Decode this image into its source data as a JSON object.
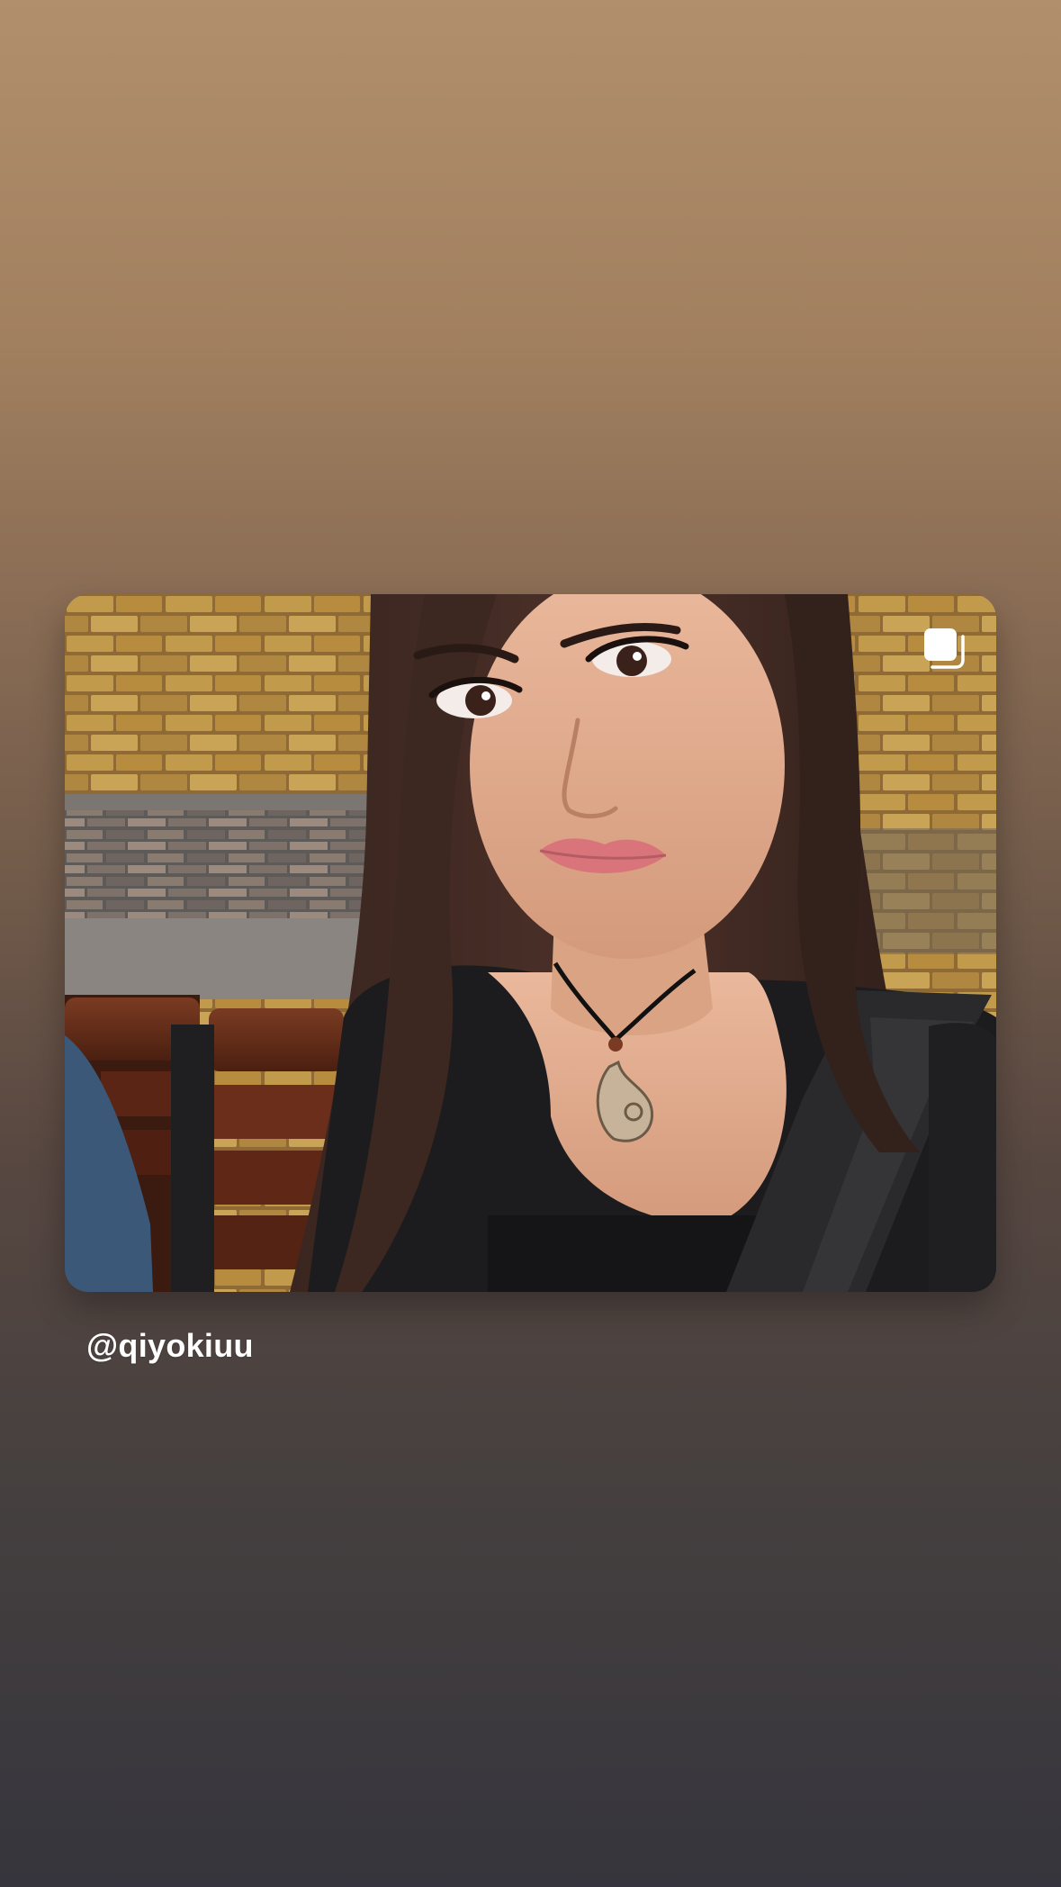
{
  "story": {
    "background_top_color": "#b18f6c",
    "background_bottom_color": "#36353d"
  },
  "post": {
    "media_type": "carousel",
    "multi_icon": "carousel-multiple-icon",
    "username": "@qiyokiuu"
  }
}
